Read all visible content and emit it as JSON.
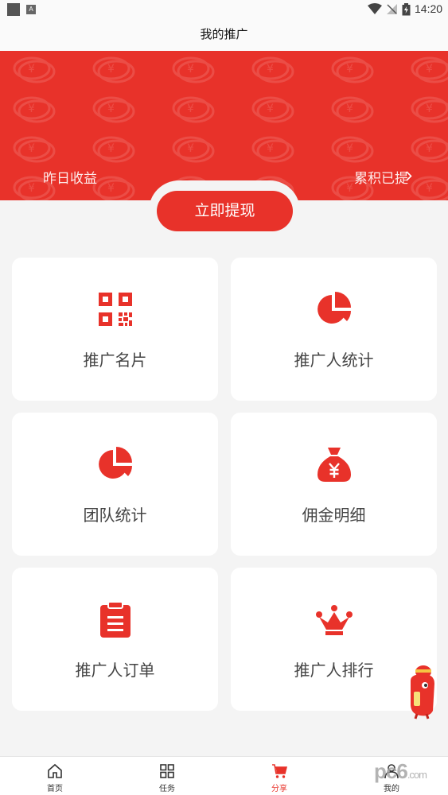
{
  "status_bar": {
    "time": "14:20"
  },
  "header": {
    "title": "我的推广"
  },
  "banner": {
    "yesterday_label": "昨日收益",
    "accumulated_label": "累积已提"
  },
  "withdraw": {
    "label": "立即提现"
  },
  "cards": [
    {
      "label": "推广名片",
      "icon": "qr-code-icon"
    },
    {
      "label": "推广人统计",
      "icon": "pie-chart-icon"
    },
    {
      "label": "团队统计",
      "icon": "pie-chart-icon"
    },
    {
      "label": "佣金明细",
      "icon": "money-bag-icon"
    },
    {
      "label": "推广人订单",
      "icon": "clipboard-icon"
    },
    {
      "label": "推广人排行",
      "icon": "crown-icon"
    }
  ],
  "tabbar": {
    "items": [
      {
        "label": "首页",
        "icon": "home-icon"
      },
      {
        "label": "任务",
        "icon": "grid-icon"
      },
      {
        "label": "分享",
        "icon": "cart-icon",
        "active": true
      },
      {
        "label": "我的",
        "icon": "user-icon"
      }
    ]
  },
  "watermark": {
    "text": "pc6",
    "suffix": ".com"
  },
  "colors": {
    "brand_red": "#e8322a",
    "background": "#f4f4f4"
  }
}
